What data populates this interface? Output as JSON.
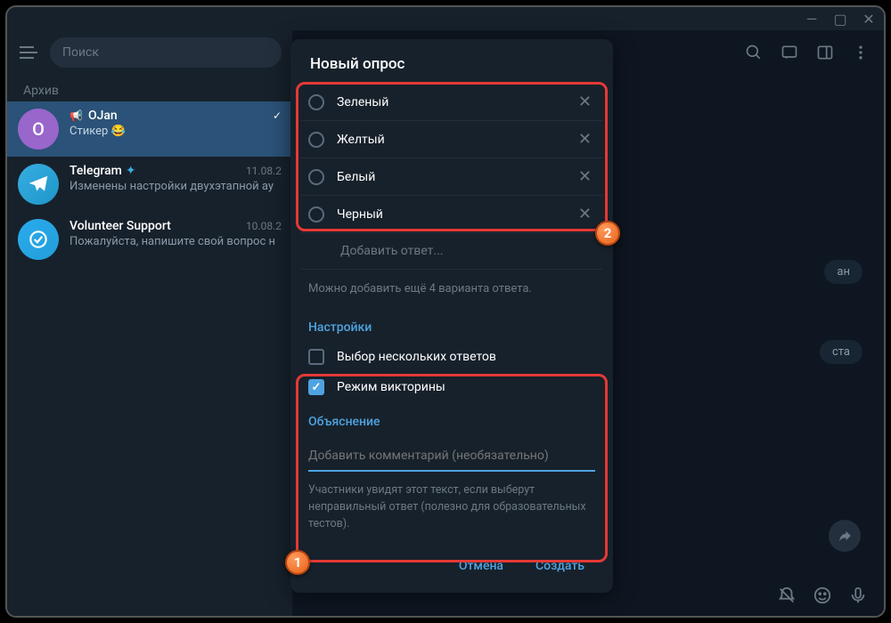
{
  "titlebar": {
    "min": "—",
    "max": "▢",
    "close": "✕"
  },
  "sidebar": {
    "search_placeholder": "Поиск",
    "archive_label": "Архив",
    "chats": [
      {
        "name": "OJan",
        "msg": "Стикер 😂",
        "speaker": true,
        "active": true,
        "avatar_letter": "O",
        "avatar_class": "purple",
        "check": true
      },
      {
        "name": "Telegram",
        "msg": "Изменены настройки двухэтапной ау",
        "date": "11.08.2",
        "verified": true,
        "avatar_class": "tg"
      },
      {
        "name": "Volunteer Support",
        "msg": "Пожалуйста, напишите свой вопрос н",
        "date": "10.08.2",
        "avatar_class": "vs"
      }
    ]
  },
  "main": {
    "pill1": "ан",
    "pill2": "ста"
  },
  "modal": {
    "title": "Новый опрос",
    "options": [
      "Зеленый",
      "Желтый",
      "Белый",
      "Черный"
    ],
    "add_option": "Добавить ответ...",
    "hint": "Можно добавить ещё 4 варианта ответа.",
    "settings_label": "Настройки",
    "multi_label": "Выбор нескольких ответов",
    "quiz_label": "Режим викторины",
    "quiz_checked": true,
    "explanation_label": "Объяснение",
    "explanation_placeholder": "Добавить комментарий (необязательно)",
    "explanation_hint": "Участники увидят этот текст, если выберут неправильный ответ (полезно для образовательных тестов).",
    "cancel": "Отмена",
    "create": "Создать"
  },
  "badges": {
    "b1": "1",
    "b2": "2"
  }
}
